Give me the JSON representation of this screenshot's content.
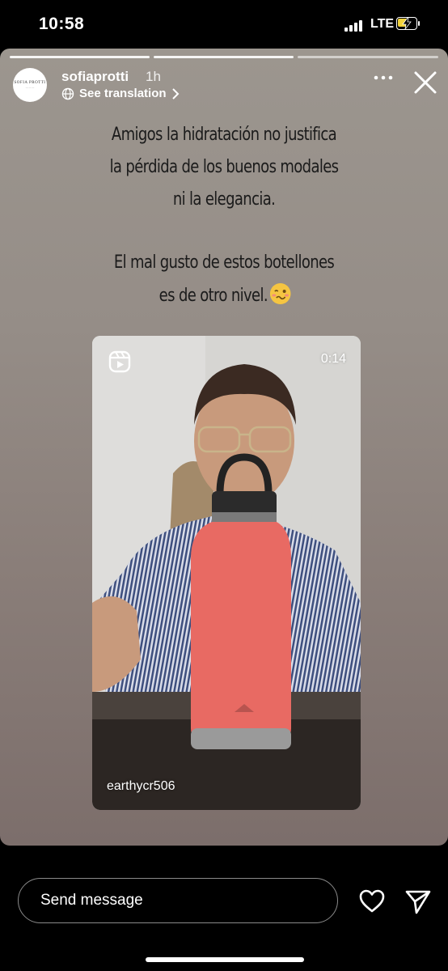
{
  "status_bar": {
    "time": "10:58",
    "network": "LTE",
    "battery_color": "#f2d33b"
  },
  "story": {
    "username": "sofiaprotti",
    "time_ago": "1h",
    "see_translation": "See translation",
    "avatar_text": "SOFIA PROTTI",
    "caption_lines": [
      "Amigos la hidratación no justifica",
      "la pérdida de los buenos modales",
      "ni la elegancia.",
      "El mal gusto de estos botellones",
      "es de otro nivel."
    ],
    "caption_emoji": "woozy-face-emoji",
    "segments_total": 3,
    "segments_viewed": 2,
    "video": {
      "duration": "0:14",
      "watermark": "earthycr506",
      "bottle_color": "#e86a63",
      "icon": "reels-icon"
    }
  },
  "footer": {
    "message_placeholder": "Send message",
    "like_icon": "heart-icon",
    "share_icon": "send-icon"
  }
}
